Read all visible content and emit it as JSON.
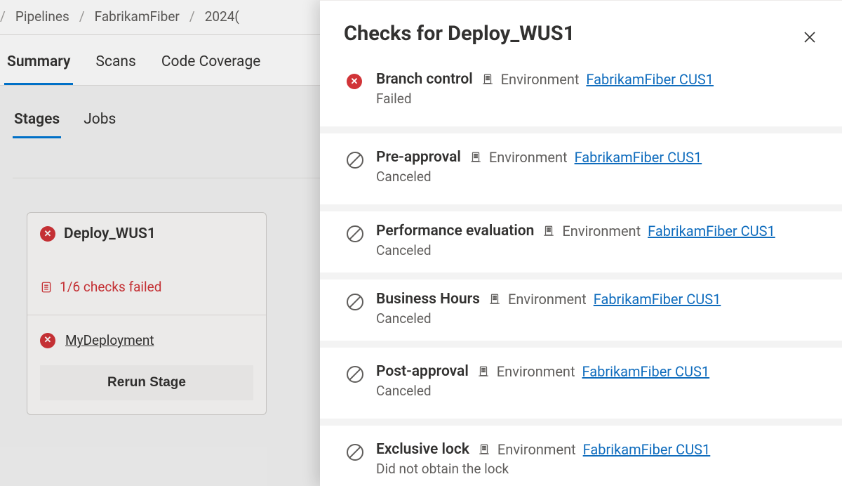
{
  "breadcrumb": {
    "items": [
      "Pipelines",
      "FabrikamFiber",
      "2024("
    ]
  },
  "tabs": {
    "summary": "Summary",
    "scans": "Scans",
    "coverage": "Code Coverage"
  },
  "subtabs": {
    "stages": "Stages",
    "jobs": "Jobs"
  },
  "stage": {
    "name": "Deploy_WUS1",
    "checks_text": "1/6 checks failed",
    "deployment": "MyDeployment",
    "rerun": "Rerun Stage"
  },
  "panel": {
    "title": "Checks for Deploy_WUS1",
    "env_label": "Environment",
    "checks": [
      {
        "name": "Branch control",
        "status": "Failed",
        "env": "FabrikamFiber CUS1",
        "icon": "fail"
      },
      {
        "name": "Pre-approval",
        "status": "Canceled",
        "env": "FabrikamFiber CUS1",
        "icon": "cancel"
      },
      {
        "name": "Performance evaluation",
        "status": "Canceled",
        "env": "FabrikamFiber CUS1",
        "icon": "cancel"
      },
      {
        "name": "Business Hours",
        "status": "Canceled",
        "env": "FabrikamFiber CUS1",
        "icon": "cancel"
      },
      {
        "name": "Post-approval",
        "status": "Canceled",
        "env": "FabrikamFiber CUS1",
        "icon": "cancel"
      },
      {
        "name": "Exclusive lock",
        "status": "Did not obtain the lock",
        "env": "FabrikamFiber CUS1",
        "icon": "cancel"
      }
    ]
  }
}
